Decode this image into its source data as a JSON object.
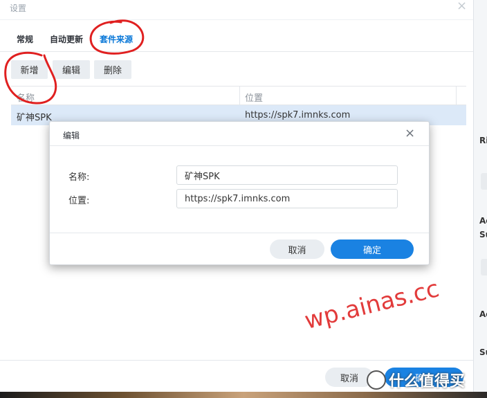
{
  "window": {
    "title": "设置",
    "close_glyph": "×"
  },
  "tabs": [
    {
      "label": "常规",
      "active": false
    },
    {
      "label": "自动更新",
      "active": false
    },
    {
      "label": "套件来源",
      "active": true
    }
  ],
  "toolbar": {
    "add_label": "新增",
    "edit_label": "编辑",
    "delete_label": "删除"
  },
  "grid": {
    "columns": [
      "名称",
      "位置"
    ],
    "rows": [
      {
        "name": "矿神SPK",
        "location": "https://spk7.imnks.com"
      }
    ]
  },
  "footer": {
    "cancel_label": "取消",
    "ok_label": "确定"
  },
  "dialog": {
    "title": "编辑",
    "close_glyph": "×",
    "name_label": "名称:",
    "name_value": "矿神SPK",
    "location_label": "位置:",
    "location_value": "https://spk7.imnks.com",
    "cancel_label": "取消",
    "ok_label": "确定"
  },
  "background_fragments": [
    "Ri",
    "Ac",
    "Su",
    "Ac",
    "Su"
  ],
  "watermark": {
    "text": "wp.ainas.cc"
  },
  "logo": {
    "text": "什么值得买"
  },
  "colors": {
    "accent": "#1a82e2",
    "selected_row": "#dce9f8",
    "annotation_red": "#e02020",
    "watermark": "#e23b3b"
  }
}
